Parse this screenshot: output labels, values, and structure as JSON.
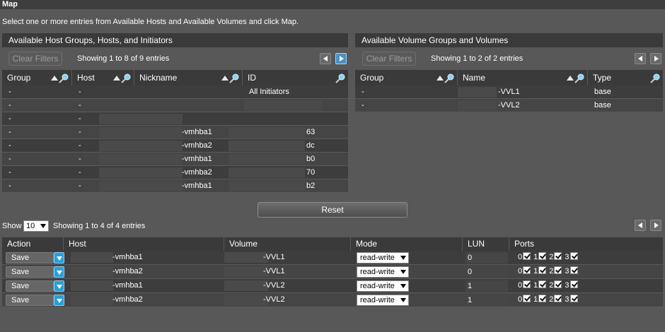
{
  "title": "Map",
  "instructions": "Select one or more entries from Available Hosts and Available Volumes and click Map.",
  "hosts_panel": {
    "heading": "Available Host Groups, Hosts, and Initiators",
    "clear_filters": "Clear Filters",
    "showing": "Showing 1 to 8 of 9 entries",
    "columns": [
      "Group",
      "Host",
      "Nickname",
      "ID"
    ],
    "rows": [
      {
        "group": "-",
        "host": "-",
        "nickname": "",
        "id": "All Initiators"
      },
      {
        "group": "-",
        "host": "-",
        "nickname": "",
        "id": ""
      },
      {
        "group": "-",
        "host": "-",
        "nickname": "",
        "id": ""
      },
      {
        "group": "-",
        "host": "-",
        "nickname": "-vmhba1",
        "id": "63"
      },
      {
        "group": "-",
        "host": "-",
        "nickname": "-vmhba2",
        "id": "dc"
      },
      {
        "group": "-",
        "host": "-",
        "nickname": "-vmhba1",
        "id": "b0"
      },
      {
        "group": "-",
        "host": "-",
        "nickname": "-vmhba2",
        "id": "70"
      },
      {
        "group": "-",
        "host": "-",
        "nickname": "-vmhba1",
        "id": "b2"
      }
    ]
  },
  "volumes_panel": {
    "heading": "Available Volume Groups and Volumes",
    "clear_filters": "Clear Filters",
    "showing": "Showing 1 to 2 of 2 entries",
    "columns": [
      "Group",
      "Name",
      "Type"
    ],
    "rows": [
      {
        "group": "-",
        "name": "-VVL1",
        "type": "base"
      },
      {
        "group": "-",
        "name": "-VVL2",
        "type": "base"
      }
    ]
  },
  "reset_label": "Reset",
  "mapping": {
    "show_label": "Show",
    "page_size": "10",
    "showing": "Showing 1 to 4 of 4 entries",
    "columns": [
      "Action",
      "Host",
      "Volume",
      "Mode",
      "LUN",
      "Ports"
    ],
    "rows": [
      {
        "action": "Save",
        "host": "-vmhba1",
        "volume": "-VVL1",
        "mode": "read-write",
        "lun": "0",
        "ports": [
          "0",
          "1",
          "2",
          "3"
        ]
      },
      {
        "action": "Save",
        "host": "-vmhba2",
        "volume": "-VVL1",
        "mode": "read-write",
        "lun": "0",
        "ports": [
          "0",
          "1",
          "2",
          "3"
        ]
      },
      {
        "action": "Save",
        "host": "-vmhba1",
        "volume": "-VVL2",
        "mode": "read-write",
        "lun": "1",
        "ports": [
          "0",
          "1",
          "2",
          "3"
        ]
      },
      {
        "action": "Save",
        "host": "-vmhba2",
        "volume": "-VVL2",
        "mode": "read-write",
        "lun": "1",
        "ports": [
          "0",
          "1",
          "2",
          "3"
        ]
      }
    ]
  },
  "colors": {
    "background": "#585858",
    "header": "#3a3a3a",
    "accent": "#2a9fd8"
  }
}
